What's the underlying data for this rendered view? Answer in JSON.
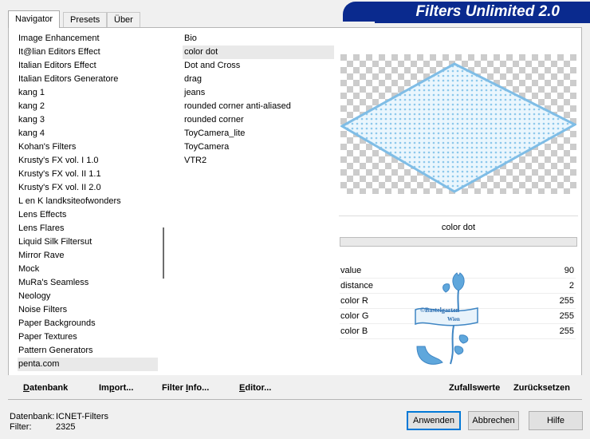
{
  "tabs": [
    "Navigator",
    "Presets",
    "Über"
  ],
  "banner": {
    "title": "Filters Unlimited 2.0"
  },
  "categories": [
    "Image Enhancement",
    "It@lian Editors Effect",
    "Italian Editors Effect",
    "Italian Editors Generatore",
    "kang 1",
    "kang 2",
    "kang 3",
    "kang 4",
    "Kohan's Filters",
    "Krusty's FX vol. I 1.0",
    "Krusty's FX vol. II 1.1",
    "Krusty's FX vol. II 2.0",
    "L en K landksiteofwonders",
    "Lens Effects",
    "Lens Flares",
    "Liquid Silk Filtersut",
    "Mirror Rave",
    "Mock",
    "MuRa's Seamless",
    "Neology",
    "Noise Filters",
    "Paper Backgrounds",
    "Paper Textures",
    "Pattern Generators",
    "penta.com"
  ],
  "selected_category": "penta.com",
  "filters": [
    "Bio",
    "color dot",
    "Dot and Cross",
    "drag",
    "jeans",
    "rounded corner anti-aliased",
    "rounded corner",
    "ToyCamera_lite",
    "ToyCamera",
    "VTR2"
  ],
  "selected_filter": "color dot",
  "preview": {
    "filter_name": "color dot",
    "watermark": "©Bastelgarten Wien"
  },
  "params": [
    {
      "label": "value",
      "value": "90"
    },
    {
      "label": "distance",
      "value": "2"
    },
    {
      "label": "color R",
      "value": "255"
    },
    {
      "label": "color G",
      "value": "255"
    },
    {
      "label": "color B",
      "value": "255"
    }
  ],
  "toolbar": {
    "db_first": "D",
    "db_rest": "atenbank",
    "import_pre": "Im",
    "import_u": "p",
    "import_post": "ort...",
    "info_pre": "Filter ",
    "info_u": "I",
    "info_post": "nfo...",
    "editor_first": "E",
    "editor_rest": "ditor...",
    "random": "Zufallswerte",
    "reset": "Zurücksetzen"
  },
  "status": {
    "db_label": "Datenbank:",
    "db_value": "ICNET-Filters",
    "filter_label": "Filter:",
    "filter_value": "2325"
  },
  "buttons": {
    "apply": "Anwenden",
    "cancel": "Abbrechen",
    "help": "Hilfe"
  },
  "colors": {
    "banner": "#0a2a8e",
    "pattern": "#8cc8ec"
  }
}
